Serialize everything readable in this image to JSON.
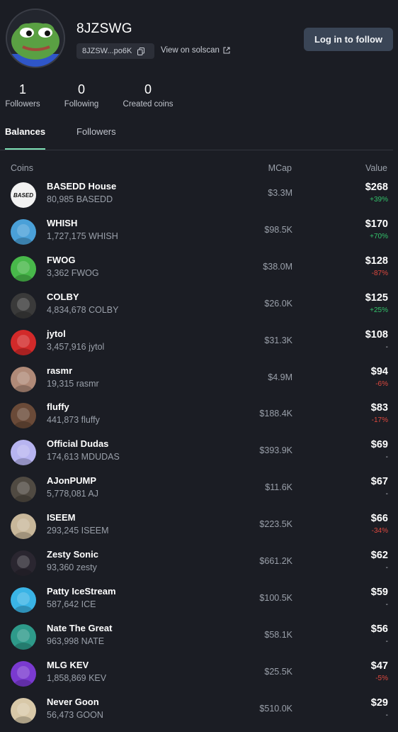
{
  "profile": {
    "username": "8JZSWG",
    "address_short": "8JZSW...po6K",
    "solscan_label": "View on solscan",
    "login_button": "Log in to follow"
  },
  "stats": [
    {
      "value": "1",
      "label": "Followers"
    },
    {
      "value": "0",
      "label": "Following"
    },
    {
      "value": "0",
      "label": "Created coins"
    }
  ],
  "tabs": [
    {
      "label": "Balances",
      "active": true
    },
    {
      "label": "Followers",
      "active": false
    }
  ],
  "table": {
    "headers": {
      "coins": "Coins",
      "mcap": "MCap",
      "value": "Value"
    },
    "rows": [
      {
        "name": "BASEDD House",
        "balance": "80,985 BASEDD",
        "mcap": "$3.3M",
        "value": "$268",
        "change": "+39%",
        "change_type": "pos",
        "avatar_color": "#f2f2f2",
        "avatar_text": "BASED"
      },
      {
        "name": "WHISH",
        "balance": "1,727,175 WHISH",
        "mcap": "$98.5K",
        "value": "$170",
        "change": "+70%",
        "change_type": "pos",
        "avatar_color": "#4aa0d8"
      },
      {
        "name": "FWOG",
        "balance": "3,362 FWOG",
        "mcap": "$38.0M",
        "value": "$128",
        "change": "-87%",
        "change_type": "neg",
        "avatar_color": "#48b84a"
      },
      {
        "name": "COLBY",
        "balance": "4,834,678 COLBY",
        "mcap": "$26.0K",
        "value": "$125",
        "change": "+25%",
        "change_type": "pos",
        "avatar_color": "#3a3a3a"
      },
      {
        "name": "jytol",
        "balance": "3,457,916 jytol",
        "mcap": "$31.3K",
        "value": "$108",
        "change": "-",
        "change_type": "neutral",
        "avatar_color": "#d22a2a"
      },
      {
        "name": "rasmr",
        "balance": "19,315 rasmr",
        "mcap": "$4.9M",
        "value": "$94",
        "change": "-6%",
        "change_type": "neg",
        "avatar_color": "#b08a78"
      },
      {
        "name": "fluffy",
        "balance": "441,873 fluffy",
        "mcap": "$188.4K",
        "value": "$83",
        "change": "-17%",
        "change_type": "neg",
        "avatar_color": "#6a4a38"
      },
      {
        "name": "Official Dudas",
        "balance": "174,613 MDUDAS",
        "mcap": "$393.9K",
        "value": "$69",
        "change": "-",
        "change_type": "neutral",
        "avatar_color": "#b7b4f0"
      },
      {
        "name": "AJonPUMP",
        "balance": "5,778,081 AJ",
        "mcap": "$11.6K",
        "value": "$67",
        "change": "-",
        "change_type": "neutral",
        "avatar_color": "#504a42"
      },
      {
        "name": "ISEEM",
        "balance": "293,245 ISEEM",
        "mcap": "$223.5K",
        "value": "$66",
        "change": "-34%",
        "change_type": "neg",
        "avatar_color": "#c8b79a"
      },
      {
        "name": "Zesty Sonic",
        "balance": "93,360 zesty",
        "mcap": "$661.2K",
        "value": "$62",
        "change": "-",
        "change_type": "neutral",
        "avatar_color": "#2a2630"
      },
      {
        "name": "Patty IceStream",
        "balance": "587,642 ICE",
        "mcap": "$100.5K",
        "value": "$59",
        "change": "-",
        "change_type": "neutral",
        "avatar_color": "#3ab4e6"
      },
      {
        "name": "Nate The Great",
        "balance": "963,998 NATE",
        "mcap": "$58.1K",
        "value": "$56",
        "change": "-",
        "change_type": "neutral",
        "avatar_color": "#2e9a8a"
      },
      {
        "name": "MLG KEV",
        "balance": "1,858,869 KEV",
        "mcap": "$25.5K",
        "value": "$47",
        "change": "-5%",
        "change_type": "neg",
        "avatar_color": "#7a3ad0"
      },
      {
        "name": "Never Goon",
        "balance": "56,473 GOON",
        "mcap": "$510.0K",
        "value": "$29",
        "change": "-",
        "change_type": "neutral",
        "avatar_color": "#d8c8a8"
      }
    ]
  }
}
